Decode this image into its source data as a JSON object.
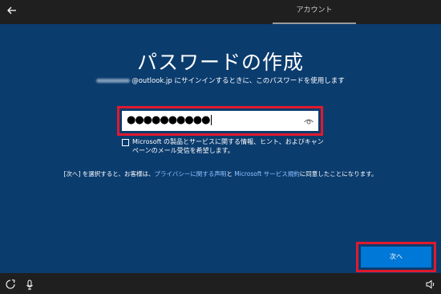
{
  "header": {
    "back_icon": "back-arrow-icon",
    "tab_label": "アカウント"
  },
  "main": {
    "title": "パスワードの作成",
    "subtitle_suffix": "@outlook.jp にサインインするときに、このパスワードを使用します",
    "password_masked": "●●●●●●●●●●",
    "reveal_icon": "eye-icon",
    "opt_in_text": "Microsoft の製品とサービスに関する情報、ヒント、およびキャンペーンのメール受信を希望します。",
    "opt_in_checked": false,
    "legal": {
      "prefix": "[次へ] を選択すると、お客様は、",
      "privacy_link": "プライバシーに関する声明",
      "middle": "と",
      "terms_link": "Microsoft サービス規約",
      "suffix": "に同意したことになります。"
    },
    "next_label": "次へ"
  },
  "footer": {
    "left_icons": [
      "ease-of-access-icon",
      "microphone-icon"
    ],
    "right_icon": "speaker-icon"
  },
  "colors": {
    "background": "#0b3c6e",
    "bar": "#1f1f1f",
    "accent": "#0078d7",
    "highlight": "#e0192e",
    "link": "#8fc3ff"
  }
}
